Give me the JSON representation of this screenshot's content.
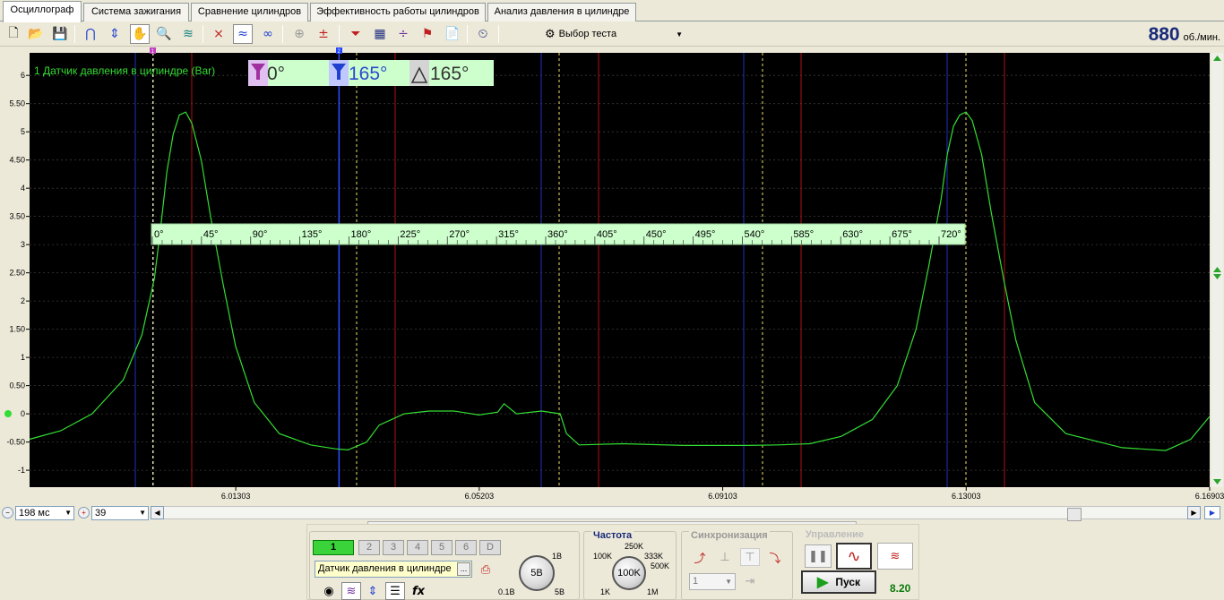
{
  "tabs": [
    {
      "label": "Осциллограф",
      "active": true
    },
    {
      "label": "Система зажигания"
    },
    {
      "label": "Сравнение цилиндров"
    },
    {
      "label": "Эффективность работы цилиндров"
    },
    {
      "label": "Анализ давления в цилиндре"
    }
  ],
  "toolbar": {
    "test_select": "Выбор теста",
    "rpm_value": "880",
    "rpm_unit": "об./мин.",
    "icons": [
      "new-file-icon",
      "open-folder-icon",
      "save-icon",
      "horseshoe-magnet-icon",
      "vertical-arrows-icon",
      "hand-icon",
      "zoom-icon",
      "filter-icon",
      "cross-signal-icon",
      "wave-stack-icon",
      "wave-loop-icon",
      "auto-disabled-icon",
      "cursor-zero-icon",
      "funnel-x-icon",
      "grid-table-icon",
      "split-icon",
      "flag-icon",
      "document-icon",
      "auto-clock-icon"
    ]
  },
  "scope": {
    "channel_label": "1 Датчик давления в цилиндре (Bar)",
    "cursor1_value": "0°",
    "cursor2_value": "165°",
    "delta_value": "165°",
    "cursor1_marker": "1",
    "cursor2_marker": "2",
    "degree_labels": [
      "0°",
      "45°",
      "90°",
      "135°",
      "180°",
      "225°",
      "270°",
      "315°",
      "360°",
      "405°",
      "450°",
      "495°",
      "540°",
      "585°",
      "630°",
      "675°",
      "720°"
    ],
    "colors": {
      "background": "#000000",
      "trace": "#33dd33",
      "degree_bar": "#ccffcc",
      "cursor1": "#c040c0",
      "cursor2": "#2244ff",
      "grid": "#555555",
      "red_line": "#b01010",
      "blue_line": "#2030c0",
      "yellow_line": "#f0e060"
    }
  },
  "chart_data": {
    "type": "line",
    "title": "1 Датчик давления в цилиндре (Bar)",
    "ylabel": "",
    "xlabel": "",
    "ylim": [
      -1.3,
      6.4
    ],
    "xlim": [
      5.98,
      6.16903
    ],
    "y_ticks": [
      "6",
      "5.50",
      "5",
      "4.50",
      "4",
      "3.50",
      "3",
      "2.50",
      "2",
      "1.50",
      "1",
      "0.50",
      "0",
      "-0.50",
      "-1"
    ],
    "x_ticks": [
      {
        "x": 6.01303,
        "label": "6.01303"
      },
      {
        "x": 6.05203,
        "label": "6.05203"
      },
      {
        "x": 6.09103,
        "label": "6.09103"
      },
      {
        "x": 6.13003,
        "label": "6.13003"
      },
      {
        "x": 6.16903,
        "label": "6.16903"
      }
    ],
    "series": [
      {
        "name": "",
        "x": [
          5.98,
          5.985,
          5.99,
          5.995,
          5.998,
          6.0,
          6.001,
          6.002,
          6.003,
          6.004,
          6.005,
          6.006,
          6.0075,
          6.009,
          6.011,
          6.013,
          6.016,
          6.02,
          6.025,
          6.029,
          6.031,
          6.034,
          6.036,
          6.04,
          6.044,
          6.048,
          6.052,
          6.055,
          6.056,
          6.058,
          6.062,
          6.065,
          6.066,
          6.068,
          6.075,
          6.085,
          6.095,
          6.1,
          6.105,
          6.11,
          6.115,
          6.119,
          6.122,
          6.124,
          6.126,
          6.127,
          6.128,
          6.129,
          6.13,
          6.131,
          6.1325,
          6.134,
          6.136,
          6.138,
          6.141,
          6.146,
          6.155,
          6.162,
          6.166,
          6.169
        ],
        "y": [
          -0.45,
          -0.3,
          0.0,
          0.6,
          1.4,
          2.4,
          3.3,
          4.3,
          4.95,
          5.3,
          5.35,
          5.15,
          4.5,
          3.5,
          2.3,
          1.2,
          0.2,
          -0.35,
          -0.55,
          -0.62,
          -0.64,
          -0.5,
          -0.2,
          0.0,
          0.05,
          0.05,
          -0.02,
          0.03,
          0.18,
          0.0,
          0.05,
          0.0,
          -0.35,
          -0.55,
          -0.53,
          -0.56,
          -0.56,
          -0.55,
          -0.53,
          -0.4,
          -0.1,
          0.5,
          1.5,
          2.6,
          3.8,
          4.6,
          5.1,
          5.3,
          5.35,
          5.2,
          4.6,
          3.6,
          2.4,
          1.3,
          0.2,
          -0.35,
          -0.6,
          -0.65,
          -0.45,
          -0.05
        ]
      }
    ]
  },
  "bottom_row": {
    "timebase": "198 мс",
    "zoom": "39"
  },
  "channels": {
    "buttons": [
      "1",
      "2",
      "3",
      "4",
      "5",
      "6",
      "D"
    ],
    "sensor": "Датчик давления в цилиндре",
    "sensor_btn": "...",
    "knob_value": "5В",
    "knob_min": "0.1В",
    "knob_max": "5В",
    "knob_top": "1В"
  },
  "frequency": {
    "title": "Частота",
    "value": "100K",
    "labels": [
      "250K",
      "100K",
      "333K",
      "500K",
      "1K",
      "1M"
    ]
  },
  "sync": {
    "title": "Синхронизация",
    "channel": "1"
  },
  "control": {
    "title": "Управление",
    "start_label": "Пуск",
    "value": "8.20"
  }
}
